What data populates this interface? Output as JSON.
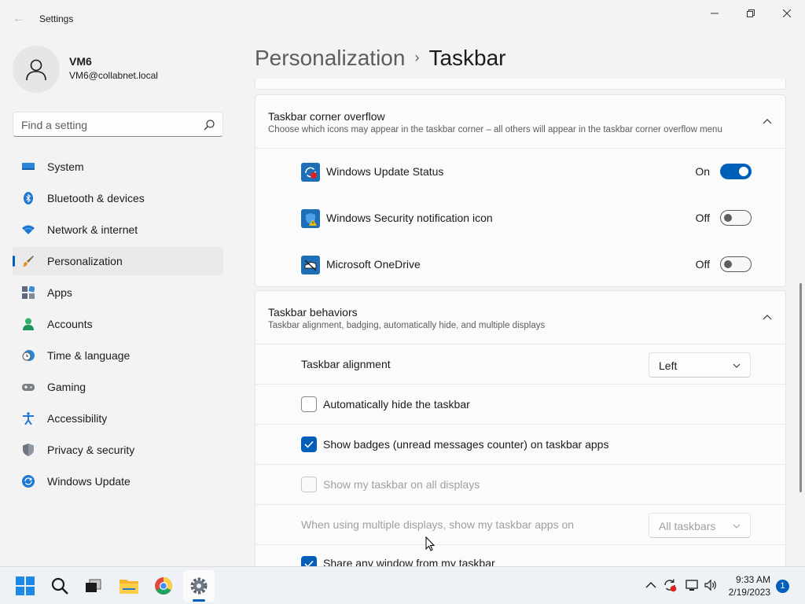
{
  "app": {
    "title": "Settings",
    "back_glyph": "←"
  },
  "user": {
    "name": "VM6",
    "email": "VM6@collabnet.local"
  },
  "search": {
    "placeholder": "Find a setting"
  },
  "sidebar": {
    "items": [
      {
        "label": "System",
        "icon": "system-icon"
      },
      {
        "label": "Bluetooth & devices",
        "icon": "bluetooth-icon"
      },
      {
        "label": "Network & internet",
        "icon": "wifi-icon"
      },
      {
        "label": "Personalization",
        "icon": "brush-icon",
        "selected": true
      },
      {
        "label": "Apps",
        "icon": "apps-icon"
      },
      {
        "label": "Accounts",
        "icon": "accounts-icon"
      },
      {
        "label": "Time & language",
        "icon": "time-language-icon"
      },
      {
        "label": "Gaming",
        "icon": "gaming-icon"
      },
      {
        "label": "Accessibility",
        "icon": "accessibility-icon"
      },
      {
        "label": "Privacy & security",
        "icon": "shield-icon"
      },
      {
        "label": "Windows Update",
        "icon": "windows-update-icon"
      }
    ]
  },
  "breadcrumb": {
    "parent": "Personalization",
    "separator": "›",
    "current": "Taskbar"
  },
  "corner_overflow": {
    "title": "Taskbar corner overflow",
    "description": "Choose which icons may appear in the taskbar corner – all others will appear in the taskbar corner overflow menu",
    "items": [
      {
        "label": "Windows Update Status",
        "state": "On",
        "on": true,
        "icon": "windows-update-status-icon"
      },
      {
        "label": "Windows Security notification icon",
        "state": "Off",
        "on": false,
        "icon": "windows-security-icon"
      },
      {
        "label": "Microsoft OneDrive",
        "state": "Off",
        "on": false,
        "icon": "onedrive-icon"
      }
    ]
  },
  "behaviors": {
    "title": "Taskbar behaviors",
    "description": "Taskbar alignment, badging, automatically hide, and multiple displays",
    "alignment_label": "Taskbar alignment",
    "alignment_value": "Left",
    "auto_hide_label": "Automatically hide the taskbar",
    "auto_hide_checked": false,
    "badges_label": "Show badges (unread messages counter) on taskbar apps",
    "badges_checked": true,
    "all_displays_label": "Show my taskbar on all displays",
    "all_displays_checked": false,
    "multi_display_label": "When using multiple displays, show my taskbar apps on",
    "multi_display_value": "All taskbars",
    "share_window_label": "Share any window from my taskbar",
    "share_window_checked": true
  },
  "taskbar": {
    "time": "9:33 AM",
    "date": "2/19/2023",
    "notification_count": "1",
    "accent": "#005fb8"
  }
}
